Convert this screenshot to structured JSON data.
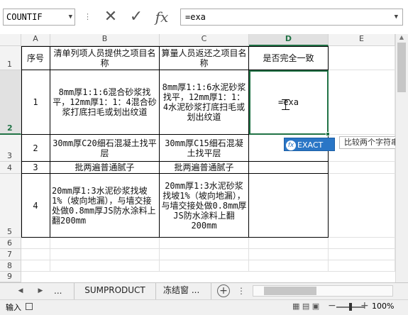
{
  "formula_bar": {
    "name_box": "COUNTIF",
    "dots": "⋮",
    "cancel_glyph": "✕",
    "enter_glyph": "✓",
    "fx_label": "fx",
    "formula": "=exa"
  },
  "sheet": {
    "columns": [
      "A",
      "B",
      "C",
      "D",
      "E"
    ],
    "rows": [
      "1",
      "2",
      "3",
      "4",
      "5",
      "6",
      "7",
      "8",
      "9"
    ],
    "header": {
      "a": "序号",
      "b": "清单列项人员提供之项目名称",
      "c": "算量人员返还之项目名称",
      "d": "是否完全一致"
    },
    "data": [
      {
        "num": "1",
        "b": "8mm厚1:1:6混合砂浆找平，12mm厚1：1：4混合砂浆打底扫毛或划出纹道",
        "c": "8mm厚1:1:6水泥砂浆找平，12mm厚1：1：4水泥砂浆打底扫毛或划出纹道",
        "d": "=exa"
      },
      {
        "num": "2",
        "b": "30mm厚C20细石混凝土找平层",
        "c": "30mm厚C15细石混凝土找平层",
        "d": ""
      },
      {
        "num": "3",
        "b": "批两遍普通腻子",
        "c": "批两遍普通腻子",
        "d": ""
      },
      {
        "num": "4",
        "b": "20mm厚1:3水泥砂浆找坡1%（坡向地漏），与墙交接处做0.8mm厚JS防水涂料上翻200mm",
        "c": "20mm厚1:3水泥砂浆找坡1%（坡向地漏），与墙交接处做0.8mm厚JS防水涂料上翻200mm",
        "d": ""
      }
    ]
  },
  "autocomplete": {
    "suggestion": "EXACT",
    "tooltip": "比较两个字符串是"
  },
  "tabs": {
    "more": "...",
    "active": "SUMPRODUCT",
    "next": "冻结窗",
    "ellipsis": "...",
    "add": "+"
  },
  "status": {
    "mode": "输入",
    "zoom": "100%"
  }
}
